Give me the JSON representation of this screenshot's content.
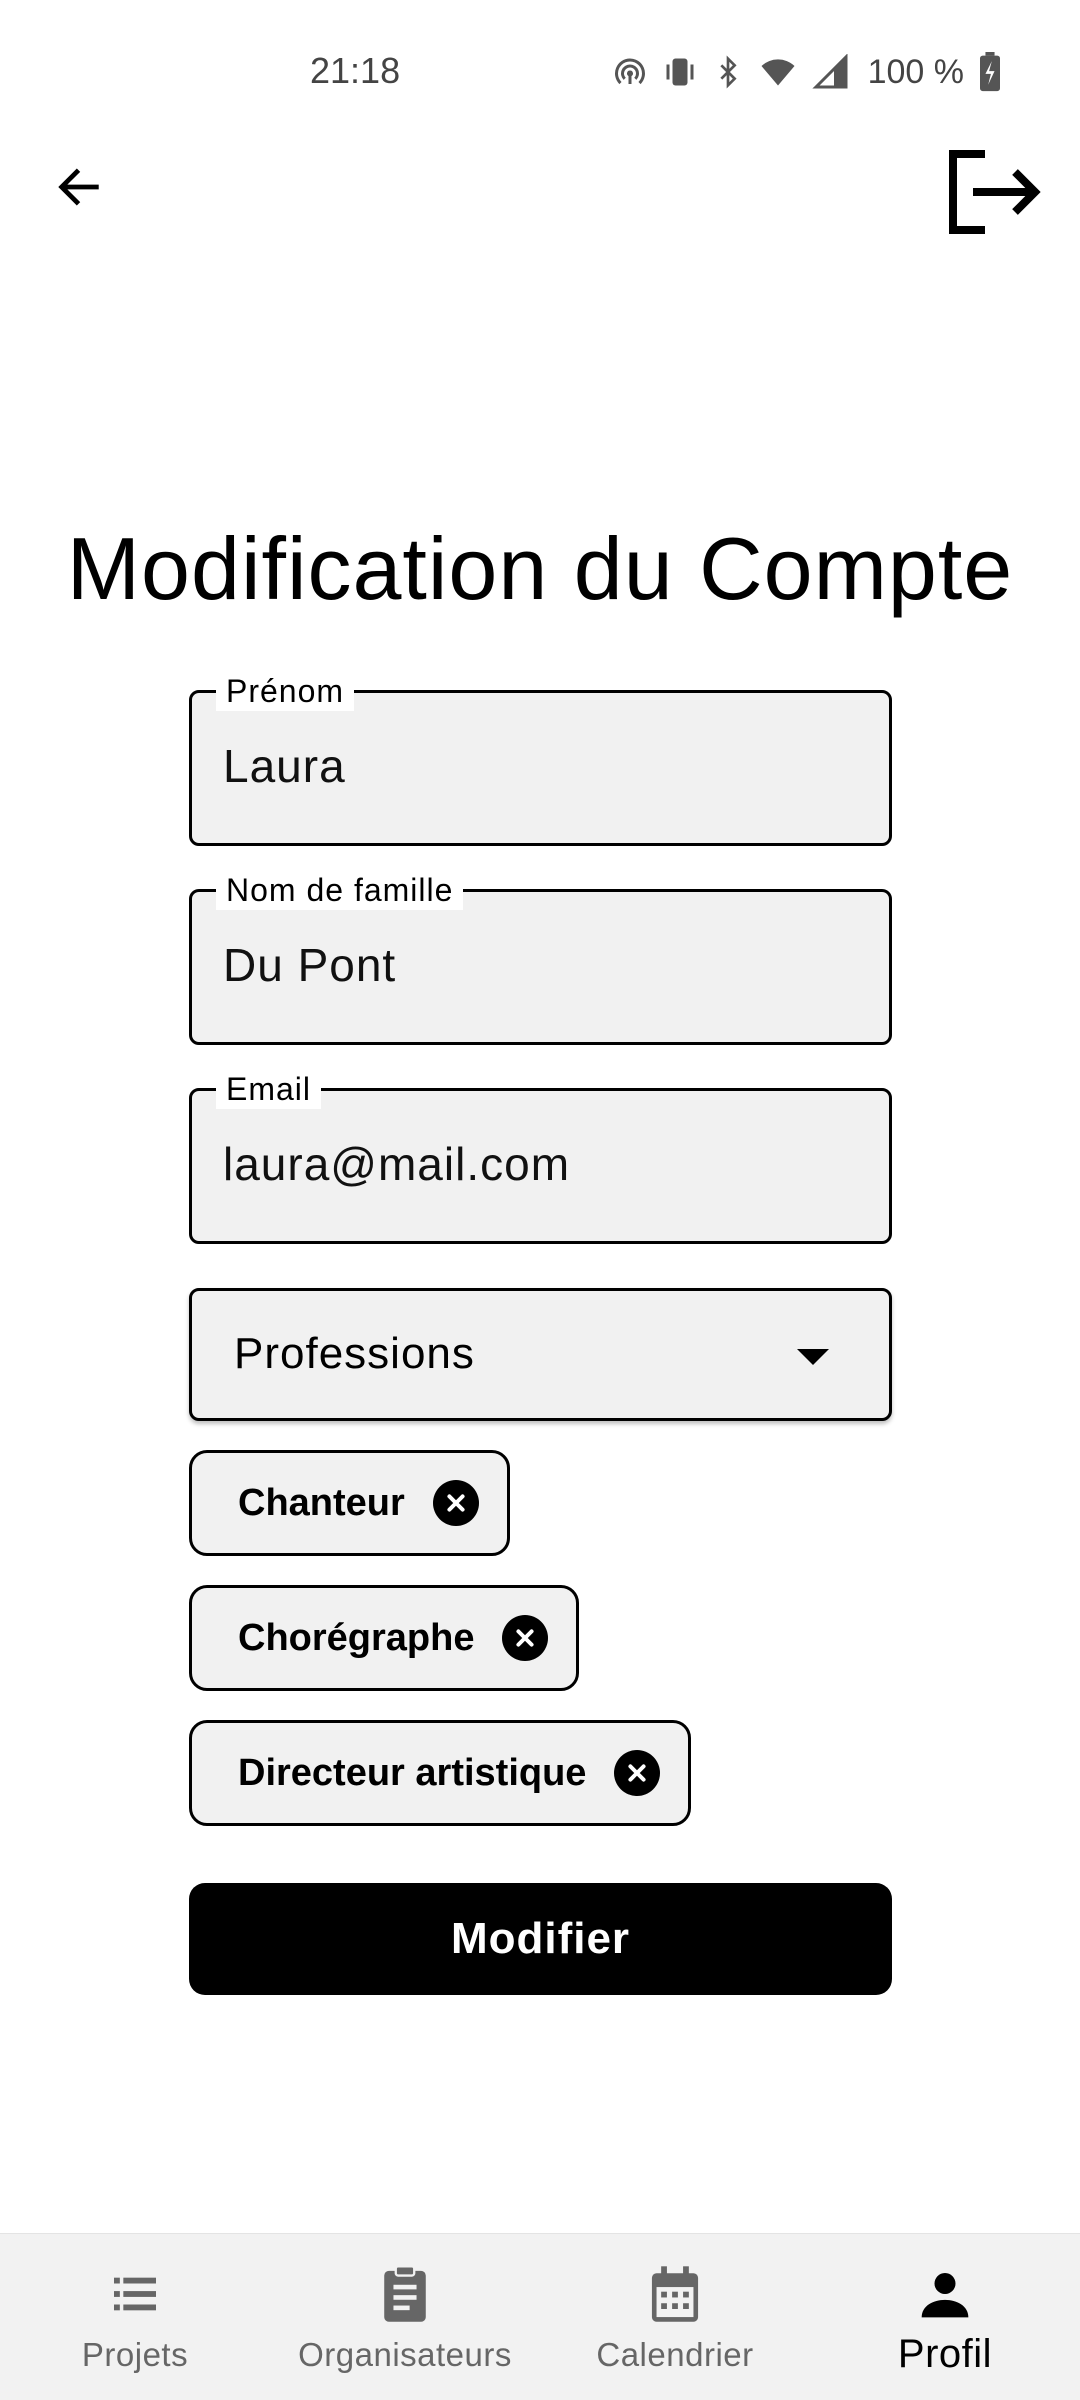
{
  "status_bar": {
    "time": "21:18",
    "battery": "100 %",
    "icons": [
      "hotspot-icon",
      "vibrate-icon",
      "bluetooth-icon",
      "wifi-icon",
      "cell-signal-icon",
      "battery-charging-icon"
    ]
  },
  "header": {
    "back_icon": "arrow-left-icon",
    "logout_icon": "logout-icon"
  },
  "page_title": "Modification du Compte",
  "form": {
    "first_name": {
      "label": "Prénom",
      "value": "Laura"
    },
    "last_name": {
      "label": "Nom de famille",
      "value": "Du Pont"
    },
    "email": {
      "label": "Email",
      "value": "laura@mail.com"
    },
    "professions": {
      "placeholder": "Professions",
      "selected": [
        "Chanteur",
        "Chorégraphe",
        "Directeur artistique"
      ]
    },
    "submit_label": "Modifier"
  },
  "nav": {
    "items": [
      {
        "label": "Projets",
        "icon": "list-icon",
        "active": false
      },
      {
        "label": "Organisateurs",
        "icon": "clipboard-icon",
        "active": false
      },
      {
        "label": "Calendrier",
        "icon": "calendar-icon",
        "active": false
      },
      {
        "label": "Profil",
        "icon": "person-icon",
        "active": true
      }
    ]
  },
  "colors": {
    "field_background": "#f1f1f1",
    "nav_background": "#f2f2f2",
    "primary": "#000000",
    "inactive_text": "#666666"
  }
}
